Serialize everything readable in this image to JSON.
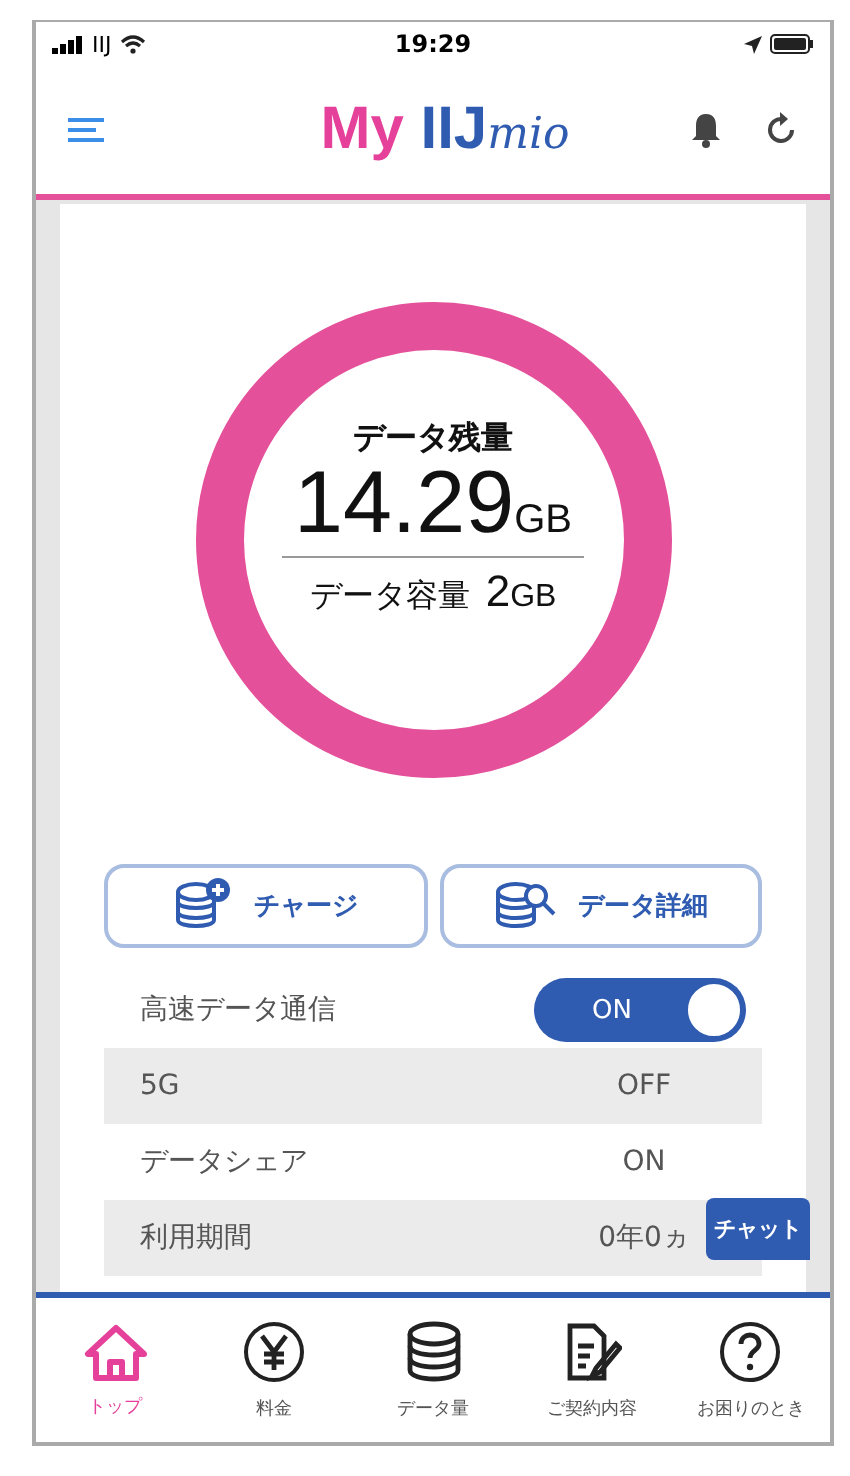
{
  "status_bar": {
    "carrier": "IIJ",
    "time": "19:29"
  },
  "header": {
    "logo": [
      "My",
      "IIJ",
      "mio"
    ]
  },
  "data_ring": {
    "title": "データ残量",
    "remaining": "14.29",
    "remaining_unit": "GB",
    "capacity_label": "データ容量",
    "capacity": "2",
    "capacity_unit": "GB"
  },
  "actions": [
    {
      "label": "チャージ"
    },
    {
      "label": "データ詳細"
    }
  ],
  "settings": [
    {
      "kind": "toggle",
      "label": "高速データ通信",
      "value": "ON",
      "on": true
    },
    {
      "kind": "text",
      "label": "5G",
      "value": "OFF"
    },
    {
      "kind": "text",
      "label": "データシェア",
      "value": "ON"
    },
    {
      "kind": "text",
      "label": "利用期間",
      "value": "0年0ヵ"
    }
  ],
  "chat_button": "チャット",
  "tabs": [
    {
      "label": "トップ",
      "selected": true
    },
    {
      "label": "料金",
      "selected": false
    },
    {
      "label": "データ量",
      "selected": false
    },
    {
      "label": "ご契約内容",
      "selected": false
    },
    {
      "label": "お困りのとき",
      "selected": false
    }
  ]
}
